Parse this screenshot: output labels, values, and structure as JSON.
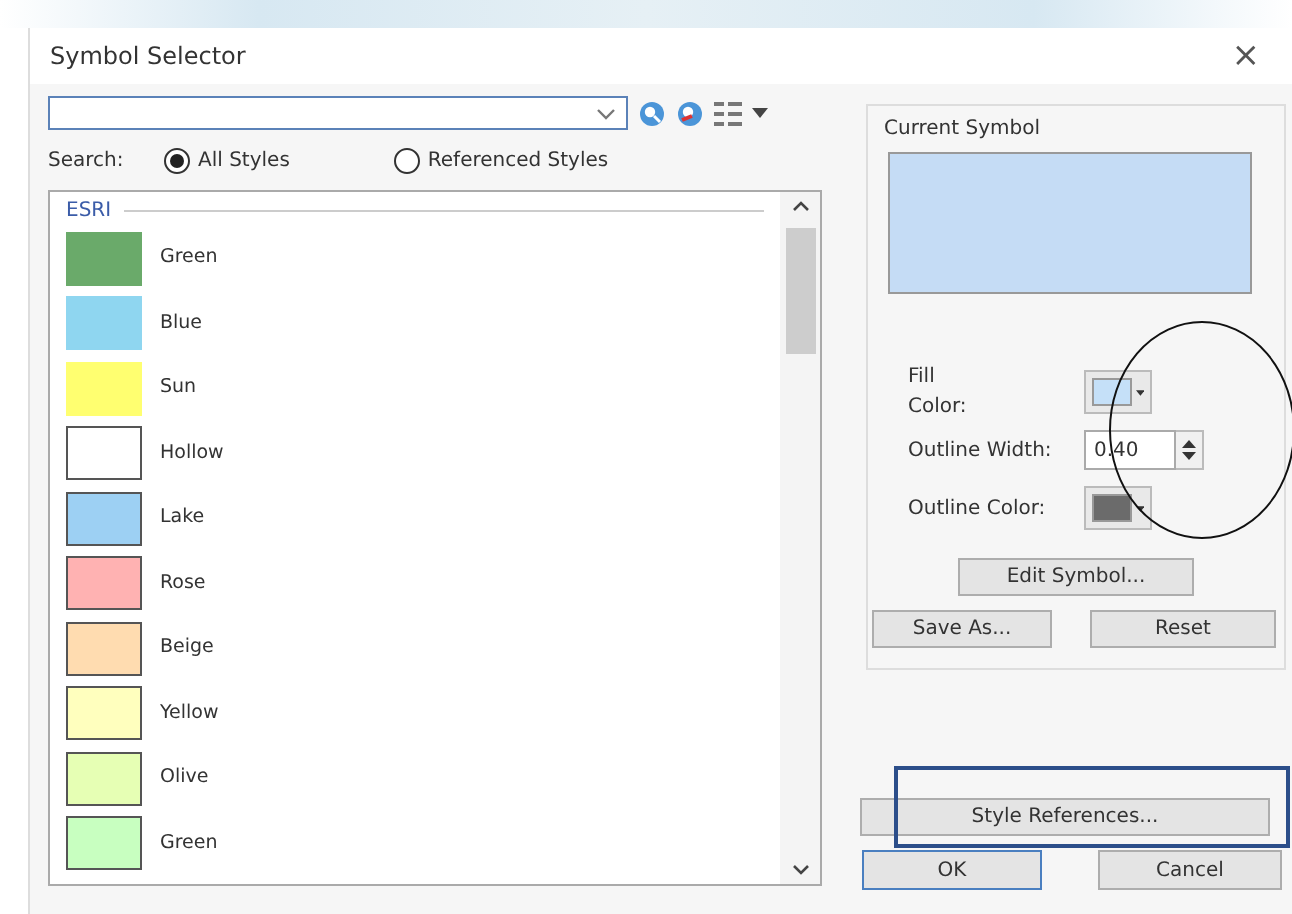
{
  "window": {
    "title": "Symbol Selector",
    "close": "×"
  },
  "search": {
    "label": "Search:",
    "scopes": [
      {
        "label": "All Styles",
        "selected": true
      },
      {
        "label": "Referenced Styles",
        "selected": false
      }
    ]
  },
  "list": {
    "group": "ESRI",
    "items": [
      {
        "name": "Green",
        "color": "#6aaa6a",
        "outlined": false
      },
      {
        "name": "Blue",
        "color": "#8fd6f0",
        "outlined": false
      },
      {
        "name": "Sun",
        "color": "#ffff70",
        "outlined": false
      },
      {
        "name": "Hollow",
        "color": "#ffffff",
        "outlined": true
      },
      {
        "name": "Lake",
        "color": "#9dd0f3",
        "outlined": true
      },
      {
        "name": "Rose",
        "color": "#ffb2b2",
        "outlined": true
      },
      {
        "name": "Beige",
        "color": "#ffdcb0",
        "outlined": true
      },
      {
        "name": "Yellow",
        "color": "#ffffbe",
        "outlined": true
      },
      {
        "name": "Olive",
        "color": "#e6ffb4",
        "outlined": true
      },
      {
        "name": "Green",
        "color": "#c8ffc0",
        "outlined": true
      }
    ]
  },
  "current_symbol": {
    "title": "Current Symbol",
    "color": "#c5dcf5"
  },
  "properties": {
    "fill": {
      "label": "Fill Color:",
      "color": "#c5e0f8"
    },
    "outline_width": {
      "label": "Outline Width:",
      "value": "0.40"
    },
    "outline": {
      "label": "Outline Color:",
      "color": "#6b6b6b"
    }
  },
  "buttons": {
    "edit_symbol": "Edit Symbol...",
    "save_as": "Save As...",
    "reset": "Reset",
    "style_references": "Style References...",
    "ok": "OK",
    "cancel": "Cancel"
  }
}
